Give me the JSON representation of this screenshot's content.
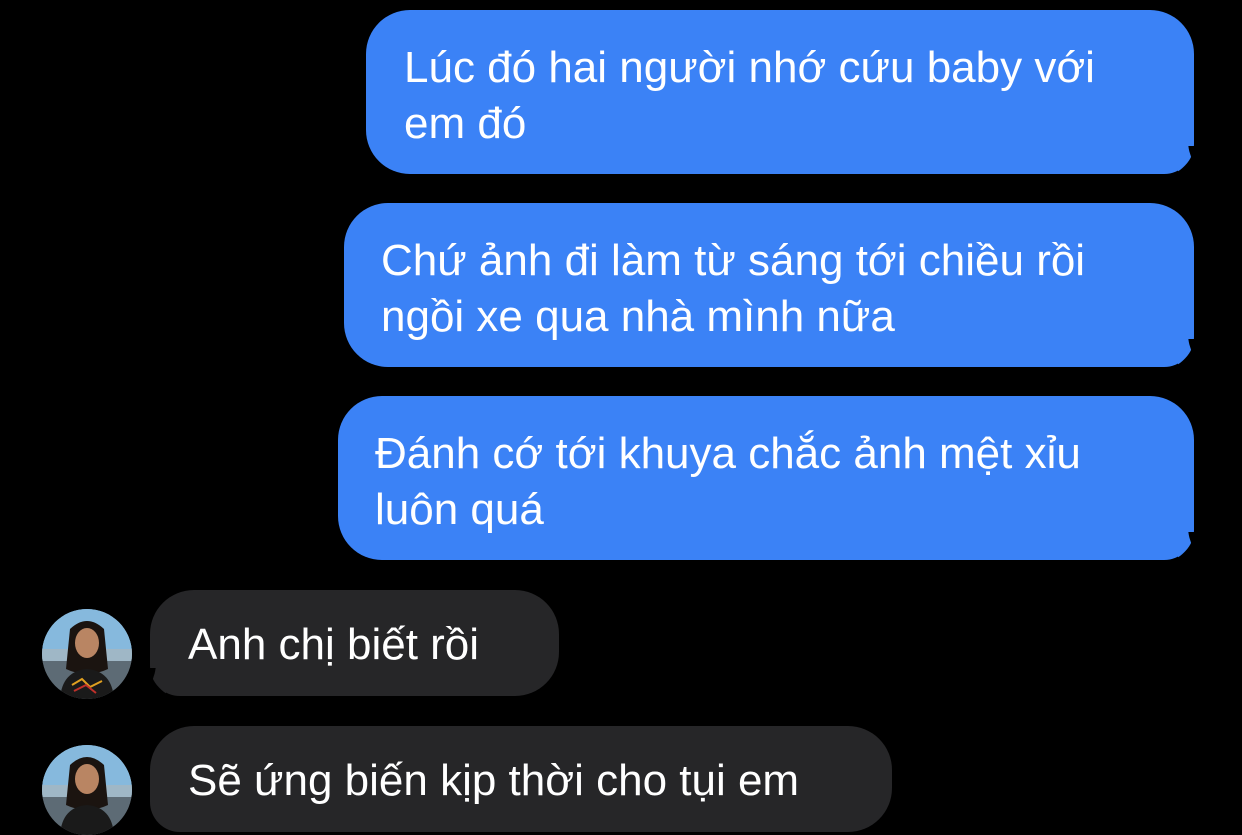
{
  "messages": [
    {
      "id": "m1",
      "direction": "outgoing",
      "text": "Lúc đó hai người nhớ cứu baby với em đó"
    },
    {
      "id": "m2",
      "direction": "outgoing",
      "text": "Chứ ảnh đi làm từ sáng tới chiều rồi ngồi xe qua nhà mình nữa"
    },
    {
      "id": "m3",
      "direction": "outgoing",
      "text": "Đánh cớ tới khuya chắc ảnh mệt xỉu luôn quá"
    },
    {
      "id": "m4",
      "direction": "incoming",
      "text": "Anh chị biết rồi"
    },
    {
      "id": "m5",
      "direction": "incoming",
      "text": "Sẽ ứng biến kịp thời cho tụi em"
    }
  ],
  "colors": {
    "background": "#000000",
    "outgoing_bubble": "#3b82f6",
    "incoming_bubble": "#262628",
    "text": "#ffffff"
  },
  "avatar": {
    "icon": "contact-avatar-photo"
  }
}
